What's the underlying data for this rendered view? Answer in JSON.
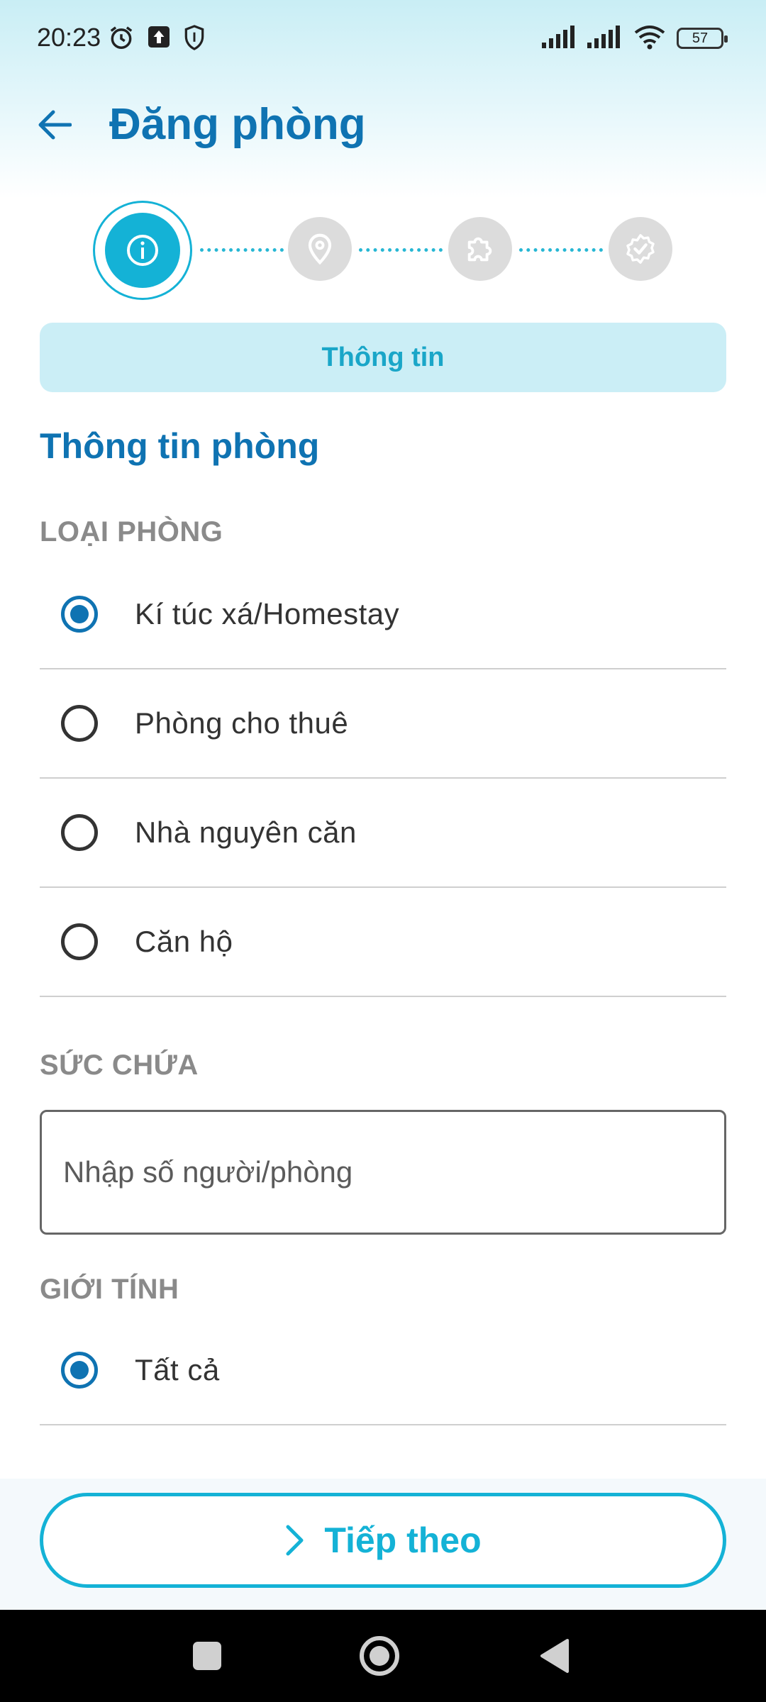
{
  "status_bar": {
    "time": "20:23",
    "battery": "57"
  },
  "header": {
    "title": "Đăng phòng"
  },
  "stepper": {
    "steps": [
      {
        "icon": "info-icon",
        "active": true
      },
      {
        "icon": "location-pin-icon",
        "active": false
      },
      {
        "icon": "puzzle-icon",
        "active": false
      },
      {
        "icon": "verified-badge-icon",
        "active": false
      }
    ]
  },
  "section_tab": "Thông tin",
  "section_heading": "Thông tin phòng",
  "room_type": {
    "label": "LOẠI PHÒNG",
    "options": [
      {
        "label": "Kí túc xá/Homestay",
        "selected": true
      },
      {
        "label": "Phòng cho thuê",
        "selected": false
      },
      {
        "label": "Nhà nguyên căn",
        "selected": false
      },
      {
        "label": "Căn hộ",
        "selected": false
      }
    ]
  },
  "capacity": {
    "label": "SỨC CHỨA",
    "placeholder": "Nhập số người/phòng",
    "value": ""
  },
  "gender": {
    "label": "GIỚI TÍNH",
    "options": [
      {
        "label": "Tất cả",
        "selected": true
      }
    ]
  },
  "next_button": {
    "label": "Tiếp theo"
  },
  "colors": {
    "primary": "#0f73b2",
    "accent": "#14b2d6",
    "pill_bg": "#cbeef6"
  }
}
